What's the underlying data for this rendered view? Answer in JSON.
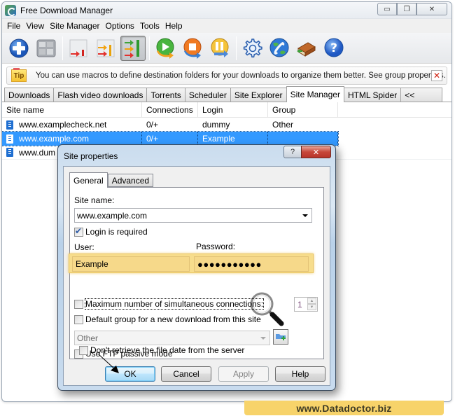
{
  "window": {
    "title": "Free Download Manager",
    "controls": {
      "minimize": "▭",
      "restore": "❐",
      "close": "✕"
    }
  },
  "menubar": [
    "File",
    "View",
    "Site Manager",
    "Options",
    "Tools",
    "Help"
  ],
  "toolbar": {
    "buttons": [
      {
        "name": "add-download",
        "icon": "plus-circle-icon"
      },
      {
        "name": "view-toggle",
        "icon": "grid-panel-icon"
      },
      {
        "name": "speed-low",
        "icon": "speed-low-icon"
      },
      {
        "name": "speed-medium",
        "icon": "speed-medium-icon"
      },
      {
        "name": "speed-high",
        "icon": "speed-high-icon",
        "pressed": true
      },
      {
        "name": "start-download",
        "icon": "play-icon"
      },
      {
        "name": "stop-download",
        "icon": "stop-icon"
      },
      {
        "name": "schedule-download",
        "icon": "pause-schedule-icon"
      },
      {
        "name": "settings",
        "icon": "gear-icon"
      },
      {
        "name": "dialup",
        "icon": "globe-phone-icon"
      },
      {
        "name": "guide",
        "icon": "book-icon"
      },
      {
        "name": "help",
        "icon": "question-icon"
      }
    ]
  },
  "tip": {
    "badge": "Tip",
    "text": "You can use macros to define destination folders for your downloads to organize them better. See group properties.",
    "close": "✕"
  },
  "tabs": [
    {
      "label": "Downloads",
      "active": false
    },
    {
      "label": "Flash video downloads",
      "active": false
    },
    {
      "label": "Torrents",
      "active": false
    },
    {
      "label": "Scheduler",
      "active": false
    },
    {
      "label": "Site Explorer",
      "active": false
    },
    {
      "label": "Site Manager",
      "active": true
    },
    {
      "label": "HTML Spider",
      "active": false
    },
    {
      "label": "<<",
      "active": false
    }
  ],
  "sites": {
    "columns": [
      "Site name",
      "Connections",
      "Login",
      "Group"
    ],
    "rows": [
      {
        "name": "www.examplecheck.net",
        "connections": "0/+",
        "login": "dummy",
        "group": "Other",
        "selected": false
      },
      {
        "name": "www.example.com",
        "connections": "0/+",
        "login": "Example",
        "group": "",
        "selected": true
      },
      {
        "name": "www.dum",
        "connections": "",
        "login": "",
        "group": "",
        "selected": false
      }
    ]
  },
  "dialog": {
    "title": "Site properties",
    "help_glyph": "?",
    "close_glyph": "✕",
    "tabs": [
      {
        "label": "General",
        "active": true
      },
      {
        "label": "Advanced",
        "active": false
      }
    ],
    "site_name_label": "Site name:",
    "site_name_value": "www.example.com",
    "login_required": {
      "label": "Login is required",
      "checked": true
    },
    "user_label": "User:",
    "user_value": "Example",
    "password_label": "Password:",
    "password_value": "●●●●●●●●●●●",
    "max_connections": {
      "label": "Maximum number of simultaneous connections:",
      "checked": false,
      "value": "1"
    },
    "default_group": {
      "label": "Default group for a new download from this site",
      "checked": false,
      "value": "Other"
    },
    "ftp_passive": {
      "label": "Use FTP passive mode",
      "checked": false
    },
    "no_file_date": {
      "label": "Don't retrieve the file date from the server",
      "checked": false
    },
    "buttons": {
      "ok": "OK",
      "cancel": "Cancel",
      "apply": "Apply",
      "help": "Help"
    }
  },
  "watermark": "www.Datadoctor.biz",
  "colors": {
    "selection": "#3399ff",
    "highlight_band": "#f7dd8c",
    "watermark_bg": "#f7d36a"
  }
}
